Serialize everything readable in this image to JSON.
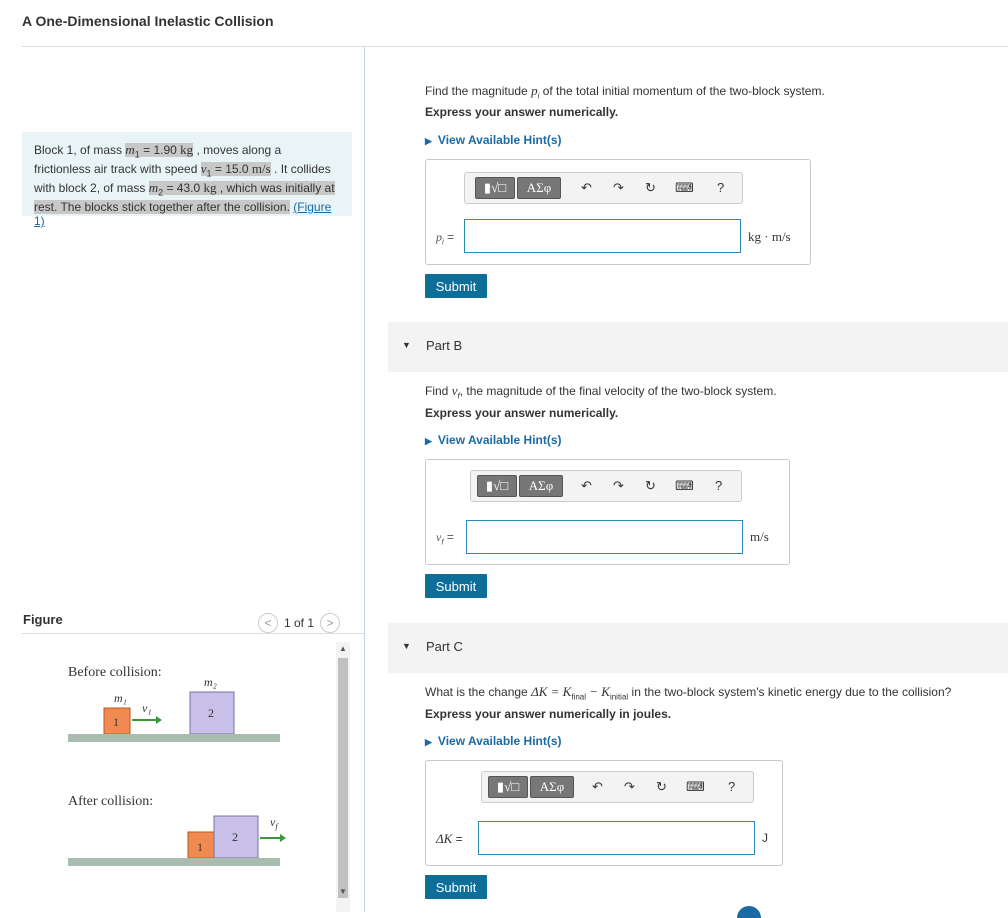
{
  "page_title": "A One-Dimensional Inelastic Collision",
  "problem": {
    "t1": "Block 1, of mass ",
    "m1_sym": "m",
    "m1_sub": "1",
    "m1_val": " = 1.90 ",
    "kg": "kg",
    "t2": " , moves along a frictionless air track with speed ",
    "v1_sym": "v",
    "v1_sub": "1",
    "v1_val": " = 15.0 ",
    "ms": "m/s",
    "t3": " . It collides with block 2, of mass ",
    "m2_sym": "m",
    "m2_sub": "2",
    "m2_val": " = 43.0 ",
    "t4": " , which was initially at rest. The blocks stick together after the collision.",
    "link": "(Figure 1)"
  },
  "figure": {
    "label": "Figure",
    "pager": "1 of 1",
    "before": "Before collision:",
    "after": "After collision:",
    "m1": "m₁",
    "m2": "m₂",
    "v1": "v₁",
    "vf": "v",
    "vf_sub": "f",
    "block1": "1",
    "block2": "2"
  },
  "partA": {
    "q_pre": "Find the magnitude ",
    "q_sym": "p",
    "q_sub": "i",
    "q_post": " of the total initial momentum of the two-block system.",
    "express": "Express your answer numerically.",
    "hint": "View Available Hint(s)",
    "label_sym": "p",
    "label_sub": "i",
    "label_eq": " =",
    "value": "",
    "unit": "kg · m/s",
    "submit": "Submit"
  },
  "partB": {
    "title": "Part B",
    "q_pre": "Find ",
    "q_sym": "v",
    "q_sub": "f",
    "q_post": ", the magnitude of the final velocity of the two-block system.",
    "express": "Express your answer numerically.",
    "hint": "View Available Hint(s)",
    "label_sym": "v",
    "label_sub": "f",
    "label_eq": " =",
    "value": "",
    "unit": "m/s",
    "submit": "Submit"
  },
  "partC": {
    "title": "Part C",
    "q_pre": "What is the change ",
    "q_eq": "ΔK = K",
    "q_sub1": "final",
    "q_minus": " − K",
    "q_sub2": "initial",
    "q_post": " in the two-block system's kinetic energy due to the collision?",
    "express": "Express your answer numerically in joules.",
    "hint": "View Available Hint(s)",
    "label": "ΔK",
    "label_eq": " =",
    "value": "",
    "unit": "J",
    "submit": "Submit"
  },
  "toolbar": {
    "templates": "▮√□",
    "symbols": "ΑΣφ",
    "undo": "↶",
    "redo": "↷",
    "reset": "↻",
    "keyboard": "⌨",
    "help": "?"
  }
}
